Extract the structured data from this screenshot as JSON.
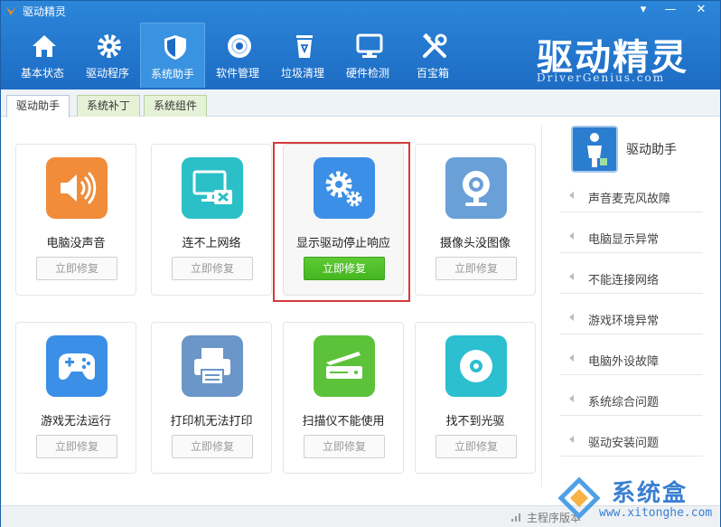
{
  "app": {
    "title": "驱动精灵",
    "minimize": "—",
    "close": "✕",
    "menu": "▾"
  },
  "nav": [
    {
      "label": "基本状态",
      "icon": "home-icon"
    },
    {
      "label": "驱动程序",
      "icon": "gear-icon"
    },
    {
      "label": "系统助手",
      "icon": "shield-icon"
    },
    {
      "label": "软件管理",
      "icon": "disc-icon"
    },
    {
      "label": "垃圾清理",
      "icon": "recycle-bin-icon"
    },
    {
      "label": "硬件检测",
      "icon": "monitor-icon"
    },
    {
      "label": "百宝箱",
      "icon": "tools-icon"
    }
  ],
  "brand": {
    "logo_text": "驱动精灵",
    "tagline": "DriverGenius.com"
  },
  "subtabs": [
    "驱动助手",
    "系统补丁",
    "系统组件"
  ],
  "cards": [
    {
      "title": "电脑没声音",
      "button": "立即修复",
      "icon": "speaker-icon",
      "color": "#f08c3a"
    },
    {
      "title": "连不上网络",
      "button": "立即修复",
      "icon": "network-monitor-icon",
      "color": "#2bbfc8"
    },
    {
      "title": "显示驱动停止响应",
      "button": "立即修复",
      "icon": "settings-gears-icon",
      "color": "#3b8fe6"
    },
    {
      "title": "摄像头没图像",
      "button": "立即修复",
      "icon": "webcam-icon",
      "color": "#6aa0d8"
    },
    {
      "title": "游戏无法运行",
      "button": "立即修复",
      "icon": "gamepad-icon",
      "color": "#3b8fe6"
    },
    {
      "title": "打印机无法打印",
      "button": "立即修复",
      "icon": "printer-icon",
      "color": "#6a96c8"
    },
    {
      "title": "扫描仪不能使用",
      "button": "立即修复",
      "icon": "scanner-icon",
      "color": "#5cc23a"
    },
    {
      "title": "找不到光驱",
      "button": "立即修复",
      "icon": "optical-disc-icon",
      "color": "#2bbfd0"
    }
  ],
  "right_panel": {
    "title": "驱动助手",
    "items": [
      "声音麦克风故障",
      "电脑显示异常",
      "不能连接网络",
      "游戏环境异常",
      "电脑外设故障",
      "系统综合问题",
      "驱动安装问题"
    ]
  },
  "status": {
    "text": "主程序版本"
  },
  "watermark": {
    "text": "系统盒",
    "url": "www.xitonghe.com"
  }
}
